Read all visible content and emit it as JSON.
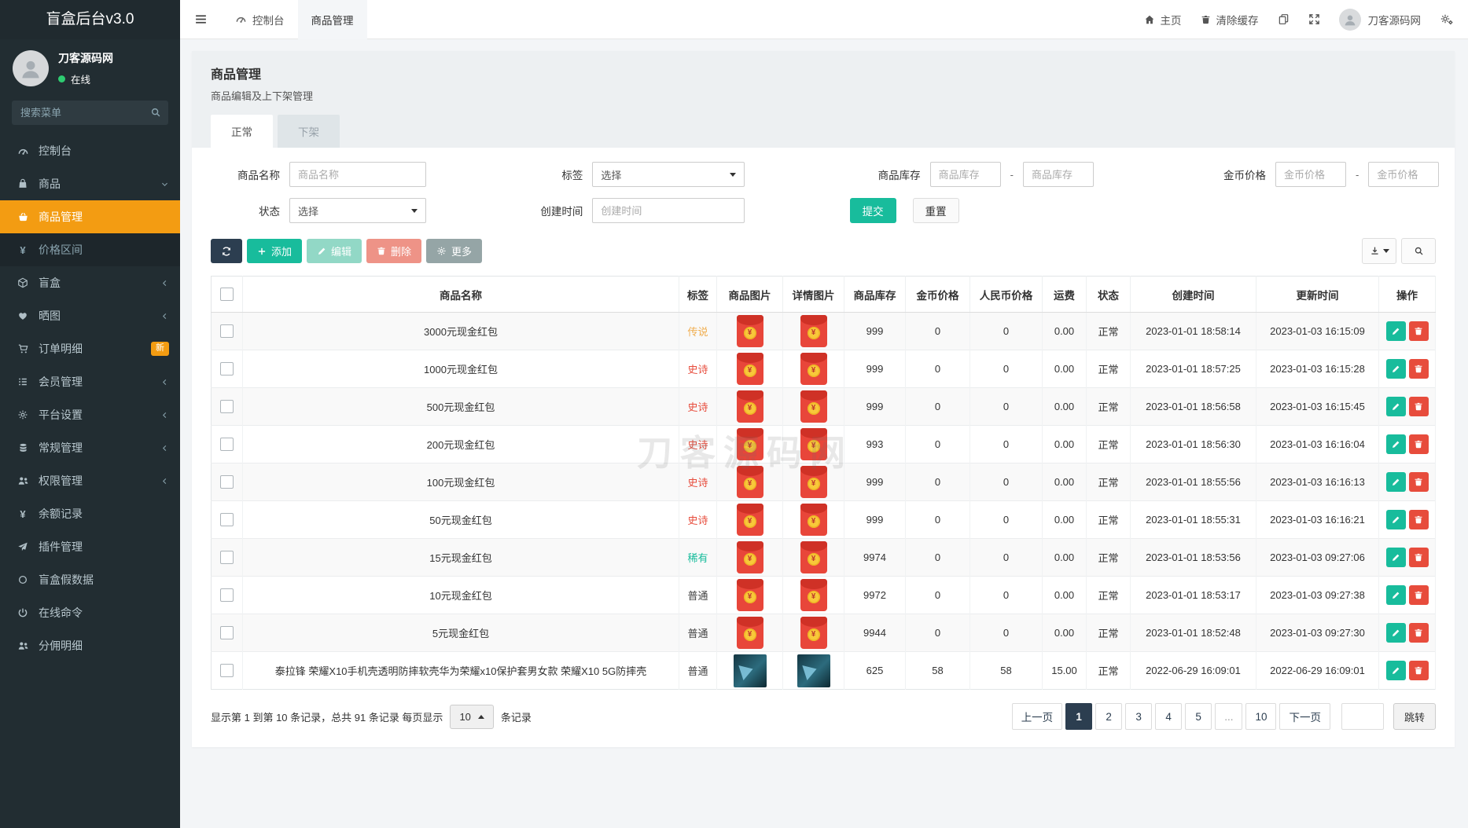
{
  "app": {
    "title": "盲盒后台v3.0"
  },
  "colors": {
    "sidebar_bg": "#222d32",
    "accent_orange": "#f39c12",
    "primary_green": "#18bc9c",
    "danger_red": "#e74c3c",
    "navy": "#2c3e50",
    "online_green": "#2ecc71",
    "tag_legend": "#f0ad4e",
    "tag_epic": "#e74c3c",
    "tag_rare": "#18bc9c",
    "tag_common": "#444444"
  },
  "sidebar": {
    "user": {
      "name": "刀客源码网",
      "status": "在线"
    },
    "search_placeholder": "搜索菜单",
    "items": [
      {
        "key": "console",
        "label": "控制台",
        "icon": "gauge-icon"
      },
      {
        "key": "goods",
        "label": "商品",
        "icon": "bag-icon",
        "chevron": "down"
      },
      {
        "key": "goods-manage",
        "label": "商品管理",
        "icon": "basket-icon",
        "active": true,
        "sub": true
      },
      {
        "key": "price-range",
        "label": "价格区间",
        "icon": "yen-icon",
        "sub": true
      },
      {
        "key": "blindbox",
        "label": "盲盒",
        "icon": "cube-icon",
        "chevron": "left"
      },
      {
        "key": "photos",
        "label": "晒图",
        "icon": "heart-icon",
        "chevron": "left"
      },
      {
        "key": "order-detail",
        "label": "订单明细",
        "icon": "cart-icon",
        "badge": "新"
      },
      {
        "key": "members",
        "label": "会员管理",
        "icon": "list-icon",
        "chevron": "left"
      },
      {
        "key": "platform-setting",
        "label": "平台设置",
        "icon": "gear-icon",
        "chevron": "left"
      },
      {
        "key": "general-manage",
        "label": "常规管理",
        "icon": "database-icon",
        "chevron": "left"
      },
      {
        "key": "permissions",
        "label": "权限管理",
        "icon": "users-icon",
        "chevron": "left"
      },
      {
        "key": "balance-log",
        "label": "余额记录",
        "icon": "yen-icon"
      },
      {
        "key": "plugins",
        "label": "插件管理",
        "icon": "paper-plane-icon"
      },
      {
        "key": "fake-data",
        "label": "盲盒假数据",
        "icon": "circle-icon"
      },
      {
        "key": "online-command",
        "label": "在线命令",
        "icon": "power-icon"
      },
      {
        "key": "commission",
        "label": "分佣明细",
        "icon": "team-icon"
      }
    ]
  },
  "topbar": {
    "console_tab": "控制台",
    "active_tab": "商品管理",
    "home": "主页",
    "clear_cache": "清除缓存",
    "username": "刀客源码网"
  },
  "page": {
    "title": "商品管理",
    "subtitle": "商品编辑及上下架管理",
    "tabs": [
      {
        "label": "正常",
        "active": true
      },
      {
        "label": "下架",
        "active": false
      }
    ]
  },
  "filters": {
    "name_label": "商品名称",
    "name_placeholder": "商品名称",
    "tag_label": "标签",
    "tag_value": "选择",
    "stock_label": "商品库存",
    "stock_placeholder": "商品库存",
    "gold_label": "金币价格",
    "gold_placeholder": "金币价格",
    "status_label": "状态",
    "status_value": "选择",
    "created_label": "创建时间",
    "created_placeholder": "创建时间",
    "range_separator": "-",
    "submit": "提交",
    "reset": "重置"
  },
  "toolbar": {
    "add": "添加",
    "edit": "编辑",
    "delete": "删除",
    "more": "更多"
  },
  "table": {
    "columns": [
      "商品名称",
      "标签",
      "商品图片",
      "详情图片",
      "商品库存",
      "金币价格",
      "人民币价格",
      "运费",
      "状态",
      "创建时间",
      "更新时间",
      "操作"
    ],
    "rows": [
      {
        "name": "3000元现金红包",
        "tag": "传说",
        "image": "redpacket",
        "stock": "999",
        "gold": "0",
        "rmb": "0",
        "shipping": "0.00",
        "status": "正常",
        "created": "2023-01-01 18:58:14",
        "updated": "2023-01-03 16:15:09"
      },
      {
        "name": "1000元现金红包",
        "tag": "史诗",
        "image": "redpacket",
        "stock": "999",
        "gold": "0",
        "rmb": "0",
        "shipping": "0.00",
        "status": "正常",
        "created": "2023-01-01 18:57:25",
        "updated": "2023-01-03 16:15:28"
      },
      {
        "name": "500元现金红包",
        "tag": "史诗",
        "image": "redpacket",
        "stock": "999",
        "gold": "0",
        "rmb": "0",
        "shipping": "0.00",
        "status": "正常",
        "created": "2023-01-01 18:56:58",
        "updated": "2023-01-03 16:15:45"
      },
      {
        "name": "200元现金红包",
        "tag": "史诗",
        "image": "redpacket",
        "stock": "993",
        "gold": "0",
        "rmb": "0",
        "shipping": "0.00",
        "status": "正常",
        "created": "2023-01-01 18:56:30",
        "updated": "2023-01-03 16:16:04"
      },
      {
        "name": "100元现金红包",
        "tag": "史诗",
        "image": "redpacket",
        "stock": "999",
        "gold": "0",
        "rmb": "0",
        "shipping": "0.00",
        "status": "正常",
        "created": "2023-01-01 18:55:56",
        "updated": "2023-01-03 16:16:13"
      },
      {
        "name": "50元现金红包",
        "tag": "史诗",
        "image": "redpacket",
        "stock": "999",
        "gold": "0",
        "rmb": "0",
        "shipping": "0.00",
        "status": "正常",
        "created": "2023-01-01 18:55:31",
        "updated": "2023-01-03 16:16:21"
      },
      {
        "name": "15元现金红包",
        "tag": "稀有",
        "image": "redpacket",
        "stock": "9974",
        "gold": "0",
        "rmb": "0",
        "shipping": "0.00",
        "status": "正常",
        "created": "2023-01-01 18:53:56",
        "updated": "2023-01-03 09:27:06"
      },
      {
        "name": "10元现金红包",
        "tag": "普通",
        "image": "redpacket",
        "stock": "9972",
        "gold": "0",
        "rmb": "0",
        "shipping": "0.00",
        "status": "正常",
        "created": "2023-01-01 18:53:17",
        "updated": "2023-01-03 09:27:38"
      },
      {
        "name": "5元现金红包",
        "tag": "普通",
        "image": "redpacket",
        "stock": "9944",
        "gold": "0",
        "rmb": "0",
        "shipping": "0.00",
        "status": "正常",
        "created": "2023-01-01 18:52:48",
        "updated": "2023-01-03 09:27:30"
      },
      {
        "name": "泰拉锋 荣耀X10手机壳透明防摔软壳华为荣耀x10保护套男女款 荣耀X10 5G防摔壳",
        "tag": "普通",
        "image": "phonecase",
        "stock": "625",
        "gold": "58",
        "rmb": "58",
        "shipping": "15.00",
        "status": "正常",
        "created": "2022-06-29 16:09:01",
        "updated": "2022-06-29 16:09:01"
      }
    ]
  },
  "watermark": "刀客源码网",
  "pagination": {
    "info_prefix": "显示第 1 到第 10 条记录，总共 91 条记录 每页显示",
    "page_size": "10",
    "info_suffix": "条记录",
    "pages": [
      "上一页",
      "1",
      "2",
      "3",
      "4",
      "5",
      "...",
      "10",
      "下一页"
    ],
    "active_page": "1",
    "jump_label": "跳转"
  }
}
